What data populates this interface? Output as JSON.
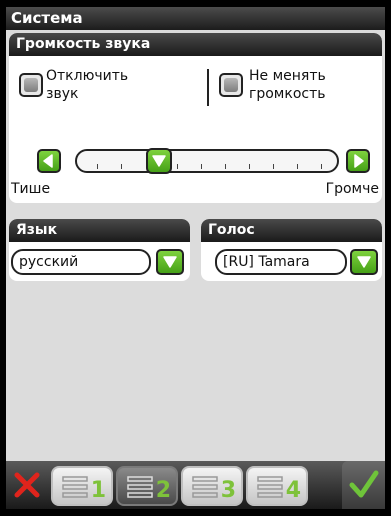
{
  "window": {
    "title": "Система"
  },
  "volume": {
    "title": "Громкость звука",
    "mute_label": "Отключить звук",
    "mute_line1": "Отключить",
    "mute_line2": "звук",
    "keep_label": "Не менять громкость",
    "keep_line1": "Не менять",
    "keep_line2": "громкость",
    "quieter_label": "Тише",
    "louder_label": "Громче",
    "level_fraction": 0.3
  },
  "language": {
    "title": "Язык",
    "value": "русский"
  },
  "voice": {
    "title": "Голос",
    "value": "[RU] Tamara"
  },
  "toolbar": {
    "tabs": [
      {
        "label": "1",
        "active": false
      },
      {
        "label": "2",
        "active": true
      },
      {
        "label": "3",
        "active": false
      },
      {
        "label": "4",
        "active": false
      }
    ],
    "cancel_icon": "close-icon",
    "ok_icon": "check-icon"
  },
  "colors": {
    "accent_green": "#5cb82a",
    "cancel_red": "#e0241c",
    "title_bar": "#2a2a2a"
  }
}
